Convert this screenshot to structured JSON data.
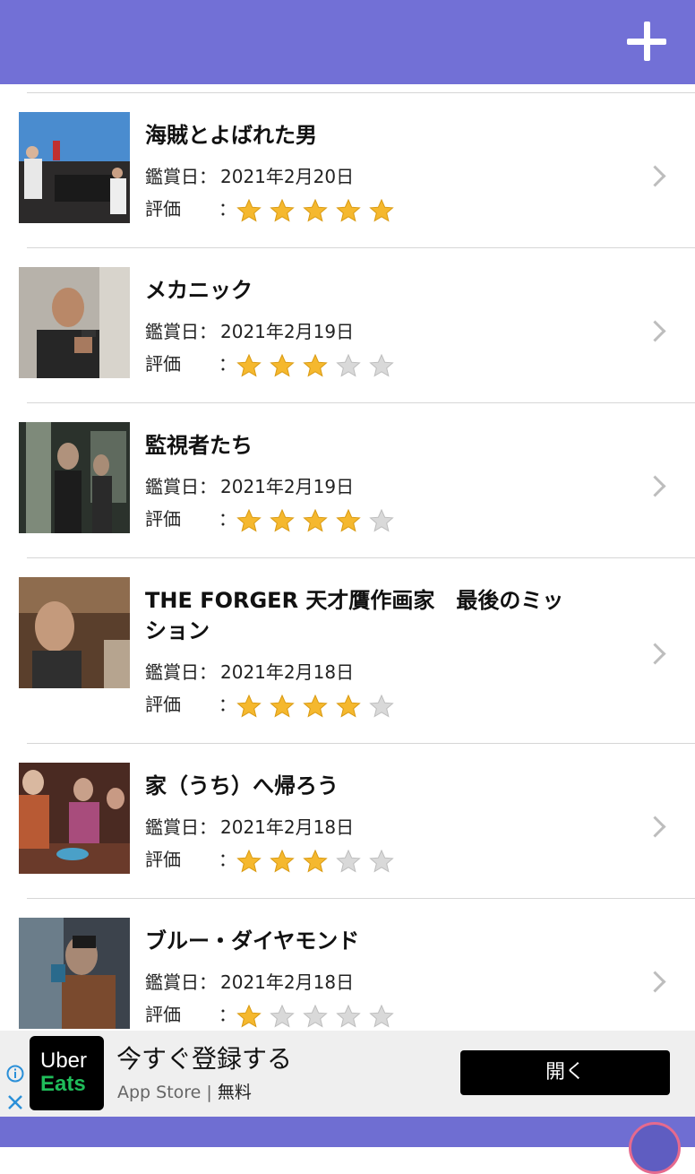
{
  "header": {
    "add_icon": "plus-icon"
  },
  "labels": {
    "date_label": "鑑賞日",
    "rating_label": "評価",
    "colon": "："
  },
  "movies": [
    {
      "title": "海賊とよばれた男",
      "date": "2021年2月20日",
      "rating": 5
    },
    {
      "title": "メカニック",
      "date": "2021年2月19日",
      "rating": 3
    },
    {
      "title": "監視者たち",
      "date": "2021年2月19日",
      "rating": 4
    },
    {
      "title": "THE FORGER 天才贋作画家　最後のミッション",
      "date": "2021年2月18日",
      "rating": 4
    },
    {
      "title": "家（うち）へ帰ろう",
      "date": "2021年2月18日",
      "rating": 3
    },
    {
      "title": "ブルー・ダイヤモンド",
      "date": "2021年2月18日",
      "rating": 1
    }
  ],
  "ad": {
    "logo_line1": "Uber",
    "logo_line2": "Eats",
    "title": "今すぐ登録する",
    "store": "App Store",
    "price": "無料",
    "open_label": "開く"
  },
  "colors": {
    "header": "#7270d6",
    "star": "#f5b82e",
    "star_empty": "#d9d9d9"
  }
}
